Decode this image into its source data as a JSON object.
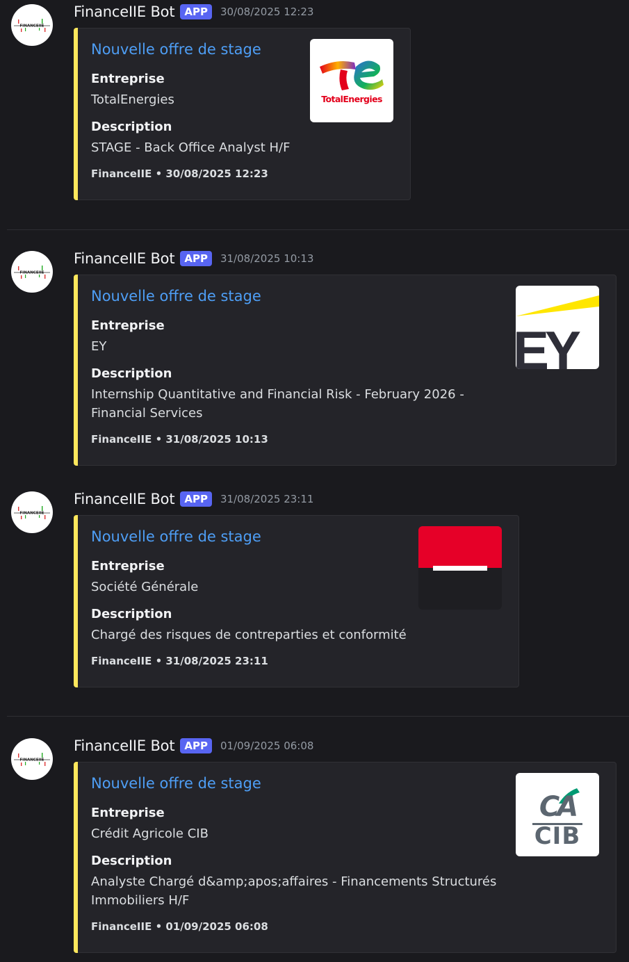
{
  "messages": [
    {
      "author": "FinanceIIE Bot",
      "badge": "APP",
      "timestamp": "30/08/2025 12:23",
      "embed": {
        "title": "Nouvelle offre de stage",
        "field_company_name": "Entreprise",
        "field_company_value": "TotalEnergies",
        "field_desc_name": "Description",
        "field_desc_value": "STAGE - Back Office Analyst H/F",
        "footer": "FinanceIIE • 30/08/2025 12:23",
        "thumbnail_logo_text": "TotalEnergies",
        "accent_color": "#fee75c"
      }
    },
    {
      "author": "FinanceIIE Bot",
      "badge": "APP",
      "timestamp": "31/08/2025 10:13",
      "embed": {
        "title": "Nouvelle offre de stage",
        "field_company_name": "Entreprise",
        "field_company_value": "EY",
        "field_desc_name": "Description",
        "field_desc_value": "Internship Quantitative and Financial Risk - February 2026 - Financial Services",
        "footer": "FinanceIIE • 31/08/2025 10:13",
        "thumbnail_logo_text": "EY",
        "accent_color": "#fee75c"
      }
    },
    {
      "author": "FinanceIIE Bot",
      "badge": "APP",
      "timestamp": "31/08/2025 23:11",
      "embed": {
        "title": "Nouvelle offre de stage",
        "field_company_name": "Entreprise",
        "field_company_value": "Société Générale",
        "field_desc_name": "Description",
        "field_desc_value": "Chargé des risques de contreparties et conformité",
        "footer": "FinanceIIE • 31/08/2025 23:11",
        "accent_color": "#fee75c"
      }
    },
    {
      "author": "FinanceIIE Bot",
      "badge": "APP",
      "timestamp": "01/09/2025 06:08",
      "embed": {
        "title": "Nouvelle offre de stage",
        "field_company_name": "Entreprise",
        "field_company_value": "Crédit Agricole CIB",
        "field_desc_name": "Description",
        "field_desc_value": "Analyste Chargé d&amp;apos;affaires - Financements Structurés Immobiliers H/F",
        "footer": "FinanceIIE • 01/09/2025 06:08",
        "thumbnail_logo_text": "CA CIB",
        "accent_color": "#fee75c"
      }
    }
  ],
  "avatar_logo_text": "FINANCEIIE",
  "colors": {
    "background": "#1a1a1e",
    "embed_background": "#242429",
    "link_blue": "#4e9ef5",
    "badge_blurple": "#5865f2",
    "timestamp_gray": "#949ba4"
  }
}
